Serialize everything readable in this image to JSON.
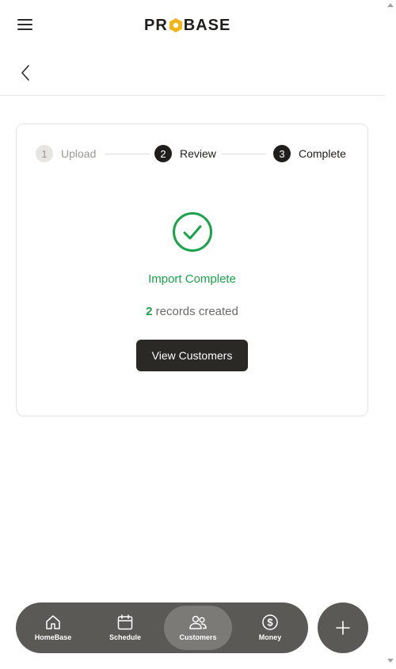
{
  "header": {
    "logo_left": "PR",
    "logo_right": "BASE",
    "menu_icon": "hamburger-icon",
    "back_icon": "chevron-left-icon"
  },
  "stepper": {
    "steps": [
      {
        "number": "1",
        "label": "Upload",
        "state": "done"
      },
      {
        "number": "2",
        "label": "Review",
        "state": "active"
      },
      {
        "number": "3",
        "label": "Complete",
        "state": "active"
      }
    ]
  },
  "result": {
    "icon": "check-circle-icon",
    "title": "Import Complete",
    "count": "2",
    "suffix": " records created",
    "button_label": "View Customers"
  },
  "bottom_nav": {
    "items": [
      {
        "label": "HomeBase",
        "icon": "home-icon"
      },
      {
        "label": "Schedule",
        "icon": "calendar-icon"
      },
      {
        "label": "Customers",
        "icon": "customers-icon",
        "selected": true
      },
      {
        "label": "Money",
        "icon": "dollar-icon"
      }
    ],
    "fab_icon": "plus-icon"
  },
  "colors": {
    "accent_green": "#1aa34a",
    "logo_hex": "#f2b418",
    "nav_bg": "#5a5956",
    "button_dark": "#2a2926"
  }
}
